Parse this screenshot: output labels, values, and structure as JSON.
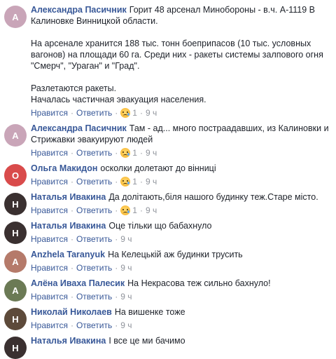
{
  "actions": {
    "like": "Нравится",
    "reply": "Ответить",
    "separator": "·"
  },
  "comments": [
    {
      "name": "Александра Пасичник",
      "text": "Горит 48 арсенал Минобороны - в.ч. А-1119 В Калиновке Винницкой области.\n\nНа арсенале хранится 188 тыс. тонн боеприпасов (10 тыс. условных вагонов) на площади 60 га. Среди них - ракеты системы залпового огня \"Смерч\", \"Ураган\" и \"Град\".\n\nРазлетаются ракеты.\nНачалась частичная эвакуация населения.",
      "reactions": "1",
      "time": "9 ч",
      "avatar_color": "#c9a5b8",
      "avatar_letter": "А"
    },
    {
      "name": "Александра Пасичник",
      "text": "Там - ад... много постраадавших, из Калиновки и Стрижавки эвакуируют людей",
      "reactions": "1",
      "time": "9 ч",
      "avatar_color": "#c9a5b8",
      "avatar_letter": "А"
    },
    {
      "name": "Ольга Макидон",
      "text": "осколки долетают до вінниці",
      "reactions": "1",
      "time": "9 ч",
      "avatar_color": "#d94b4b",
      "avatar_letter": "О"
    },
    {
      "name": "Наталья Ивакина",
      "text": "Да долітають,біля нашого будинку теж.Старе місто.",
      "reactions": "1",
      "time": "9 ч",
      "avatar_color": "#3a3030",
      "avatar_letter": "Н"
    },
    {
      "name": "Наталья Ивакина",
      "text": "Оце тільки що бабахнуло",
      "reactions": "",
      "time": "9 ч",
      "avatar_color": "#3a3030",
      "avatar_letter": "Н"
    },
    {
      "name": "Anzhela Taranyuk",
      "text": "На Келецькій аж будинки трусить",
      "reactions": "",
      "time": "9 ч",
      "avatar_color": "#b57a6a",
      "avatar_letter": "A"
    },
    {
      "name": "Алёна Иваха Палесик",
      "text": "На Некрасова теж сильно бахнуло!",
      "reactions": "",
      "time": "9 ч",
      "avatar_color": "#6b7a55",
      "avatar_letter": "А"
    },
    {
      "name": "Николай Николаев",
      "text": "На вишенке тоже",
      "reactions": "",
      "time": "9 ч",
      "avatar_color": "#5d4a3a",
      "avatar_letter": "Н"
    },
    {
      "name": "Наталья Ивакина",
      "text": "І все це ми бачимо",
      "reactions": "",
      "time": "",
      "avatar_color": "#3a3030",
      "avatar_letter": "Н"
    }
  ]
}
